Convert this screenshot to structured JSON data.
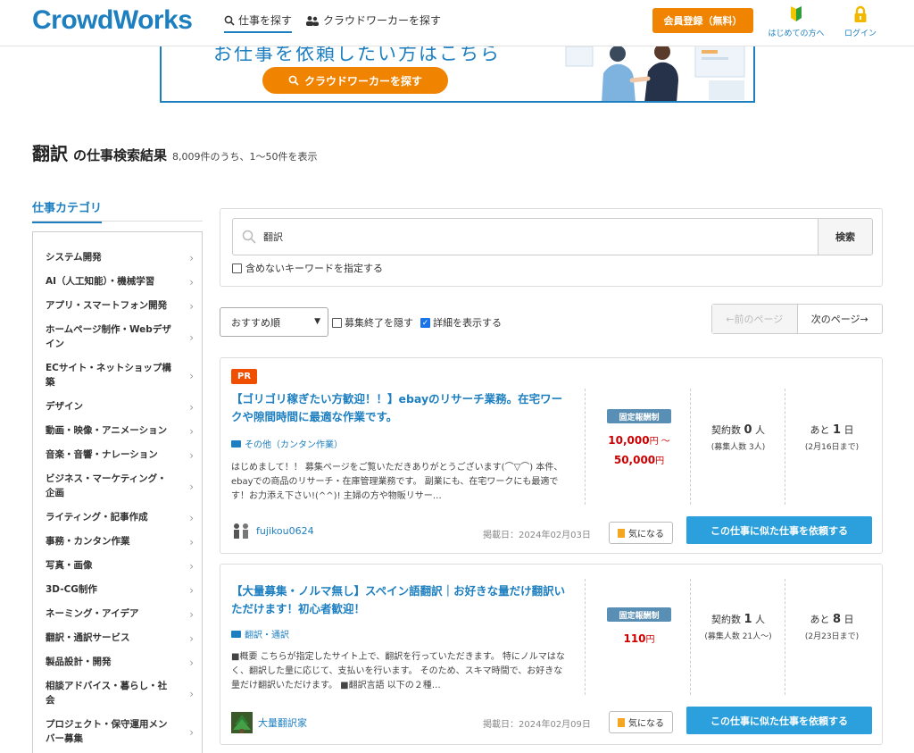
{
  "header": {
    "logo": "CrowdWorks",
    "nav": [
      {
        "label": "仕事を探す",
        "active": true
      },
      {
        "label": "クラウドワーカーを探す",
        "active": false
      }
    ],
    "register_label": "会員登録（無料）",
    "beginners_label": "はじめての方へ",
    "login_label": "ログイン"
  },
  "banner": {
    "text": "お仕事を依頼したい方はこちら",
    "button_label": "クラウドワーカーを探す"
  },
  "results": {
    "keyword": "翻訳",
    "label": "の仕事検索結果",
    "count_text": "8,009件のうち、1〜50件を表示"
  },
  "sidebar": {
    "title": "仕事カテゴリ",
    "items": [
      "システム開発",
      "AI（人工知能）・機械学習",
      "アプリ・スマートフォン開発",
      "ホームページ制作・Webデザイン",
      "ECサイト・ネットショップ構築",
      "デザイン",
      "動画・映像・アニメーション",
      "音楽・音響・ナレーション",
      "ビジネス・マーケティング・企画",
      "ライティング・記事作成",
      "事務・カンタン作業",
      "写真・画像",
      "3D-CG制作",
      "ネーミング・アイデア",
      "翻訳・通訳サービス",
      "製品設計・開発",
      "相談アドバイス・暮らし・社会",
      "プロジェクト・保守運用メンバー募集"
    ]
  },
  "search": {
    "value": "翻訳",
    "button_label": "検索",
    "exclude_label": "含めないキーワードを指定する"
  },
  "sort": {
    "selected": "おすすめ順",
    "hide_closed_label": "募集終了を隠す",
    "show_details_label": "詳細を表示する",
    "prev_label": "←前のページ",
    "next_label": "次のページ→"
  },
  "jobs": [
    {
      "pr": "PR",
      "title": "【ゴリゴリ稼ぎたい方歓迎！！】ebayのリサーチ業務。在宅ワークや隙間時間に最適な作業です。",
      "category": "その他（カンタン作業）",
      "description": "はじめまして！！ 募集ページをご覧いただきありがとうございます(⌒▽⌒) 本件、ebayでの商品のリサーチ・在庫管理業務です。 副業にも、在宅ワークにも最適です！お力添え下さい!(^^)! 主婦の方や物販リサー…",
      "client": "fujikou0624",
      "date": "掲載日：2024年02月03日",
      "fav_label": "気になる",
      "cta_label": "この仕事に似た仕事を依頼する",
      "pay_type": "固定報酬制",
      "price_min": "10,000",
      "price_max": "50,000",
      "price_unit": "円",
      "price_sep": " 〜",
      "contracts_label": "契約数",
      "contracts": "0",
      "contracts_unit": "人",
      "recruit": "(募集人数 3人)",
      "remaining_label": "あと",
      "remaining": "1",
      "remaining_unit": "日",
      "deadline": "(2月16日まで)"
    },
    {
      "title": "【大量募集・ノルマ無し】スペイン語翻訳｜お好きな量だけ翻訳いただけます！初心者歓迎！",
      "category": "翻訳・通訳",
      "description": "■概要 こちらが指定したサイト上で、翻訳を行っていただきます。 特にノルマはなく、翻訳した量に応じて、支払いを行います。 そのため、スキマ時間で、お好きな量だけ翻訳いただけます。 ■翻訳言語 以下の２種…",
      "client": "大量翻訳家",
      "date": "掲載日：2024年02月09日",
      "fav_label": "気になる",
      "cta_label": "この仕事に似た仕事を依頼する",
      "pay_type": "固定報酬制",
      "price_min": "110",
      "price_unit": "円",
      "contracts_label": "契約数",
      "contracts": "1",
      "contracts_unit": "人",
      "recruit": "(募集人数 21人〜)",
      "remaining_label": "あと",
      "remaining": "8",
      "remaining_unit": "日",
      "deadline": "(2月23日まで)"
    }
  ]
}
